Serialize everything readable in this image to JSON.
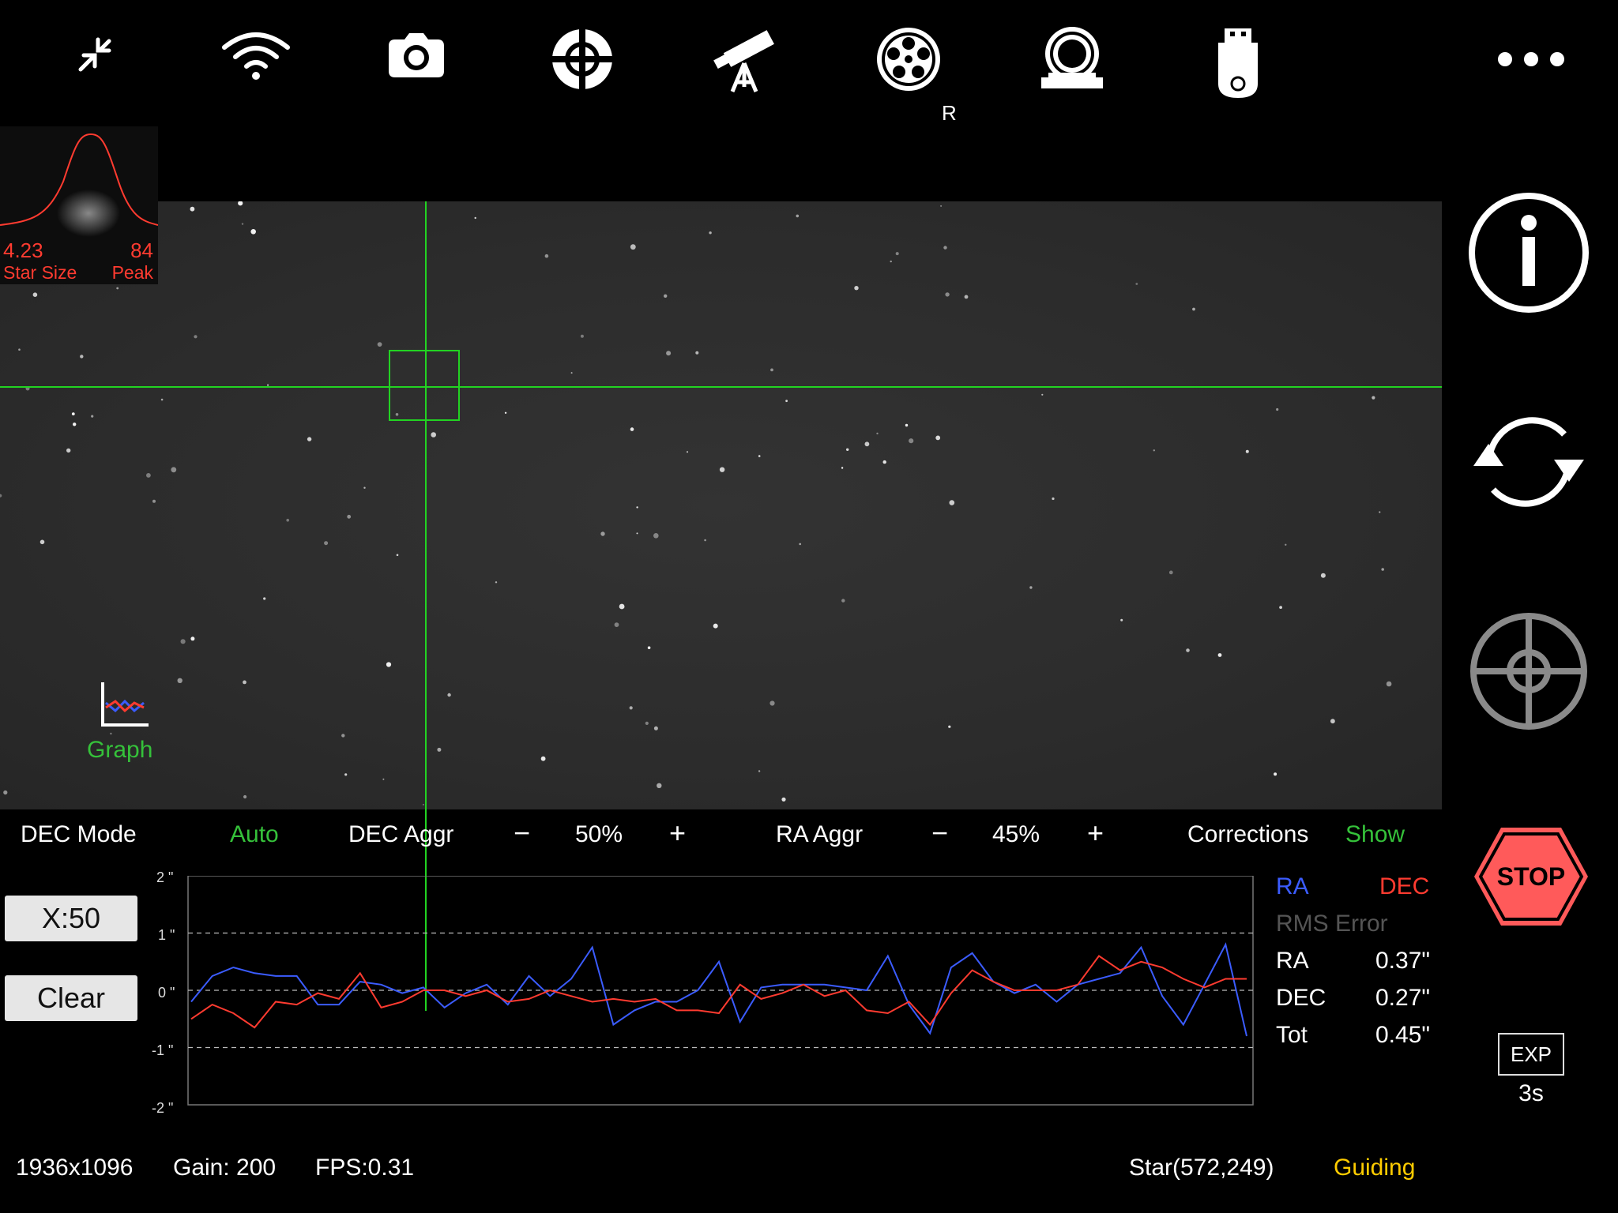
{
  "toolbar": {
    "icons": [
      "collapse-icon",
      "wifi-icon",
      "camera-icon",
      "guide-target-icon",
      "telescope-icon",
      "filter-wheel-icon",
      "focuser-icon",
      "usb-storage-icon",
      "more-icon"
    ],
    "filter_label": "R"
  },
  "star_profile": {
    "star_size": "4.23",
    "star_size_label": "Star Size",
    "peak": "84",
    "peak_label": "Peak"
  },
  "graph_toggle": {
    "label": "Graph"
  },
  "controls": {
    "dec_mode_label": "DEC Mode",
    "dec_mode_value": "Auto",
    "dec_aggr_label": "DEC Aggr",
    "dec_aggr_value": "50%",
    "ra_aggr_label": "RA Aggr",
    "ra_aggr_value": "45%",
    "corrections_label": "Corrections",
    "corrections_value": "Show",
    "minus": "−",
    "plus": "+"
  },
  "graph_buttons": {
    "scale": "X:50",
    "clear": "Clear"
  },
  "graph_axis": [
    "2 \"",
    "1 \"",
    "0 \"",
    "-1 \"",
    "-2 \""
  ],
  "legend": {
    "ra": "RA",
    "dec": "DEC",
    "rms_title": "RMS Error"
  },
  "rms": [
    {
      "label": "RA",
      "value": "0.37\""
    },
    {
      "label": "DEC",
      "value": "0.27\""
    },
    {
      "label": "Tot",
      "value": "0.45\""
    }
  ],
  "exposure": {
    "label": "EXP",
    "value": "3s"
  },
  "status": {
    "resolution": "1936x1096",
    "gain": "Gain: 200",
    "fps": "FPS:0.31",
    "star": "Star(572,249)",
    "state": "Guiding"
  },
  "colors": {
    "ra": "#3b5cff",
    "dec": "#ff3b30",
    "crosshair": "#22d322",
    "guiding": "#ffcc00",
    "accent_green": "#35c13a",
    "stop": "#ff5a5a"
  },
  "chart_data": {
    "type": "line",
    "ylim": [
      -2,
      2
    ],
    "series": [
      {
        "name": "RA",
        "values": [
          -0.2,
          0.25,
          0.4,
          0.3,
          0.25,
          0.25,
          -0.25,
          -0.25,
          0.15,
          0.1,
          -0.05,
          0.05,
          -0.3,
          -0.05,
          0.1,
          -0.25,
          0.25,
          -0.1,
          0.2,
          0.75,
          -0.6,
          -0.35,
          -0.2,
          -0.2,
          0.0,
          0.5,
          -0.55,
          0.05,
          0.1,
          0.1,
          0.1,
          0.05,
          0.0,
          0.6,
          -0.25,
          -0.75,
          0.4,
          0.65,
          0.15,
          -0.05,
          0.1,
          -0.2,
          0.1,
          0.2,
          0.3,
          0.75,
          -0.1,
          -0.6,
          0.1,
          0.8,
          -0.8
        ]
      },
      {
        "name": "DEC",
        "values": [
          -0.5,
          -0.25,
          -0.4,
          -0.65,
          -0.2,
          -0.25,
          -0.05,
          -0.15,
          0.3,
          -0.3,
          -0.2,
          0.0,
          0.0,
          -0.1,
          0.0,
          -0.2,
          -0.15,
          0.0,
          -0.1,
          -0.2,
          -0.15,
          -0.2,
          -0.15,
          -0.35,
          -0.35,
          -0.4,
          0.1,
          -0.15,
          -0.05,
          0.1,
          -0.1,
          0.0,
          -0.35,
          -0.4,
          -0.2,
          -0.6,
          -0.05,
          0.35,
          0.15,
          0.0,
          0.0,
          0.0,
          0.1,
          0.6,
          0.35,
          0.5,
          0.4,
          0.2,
          0.05,
          0.2,
          0.2
        ]
      }
    ]
  }
}
